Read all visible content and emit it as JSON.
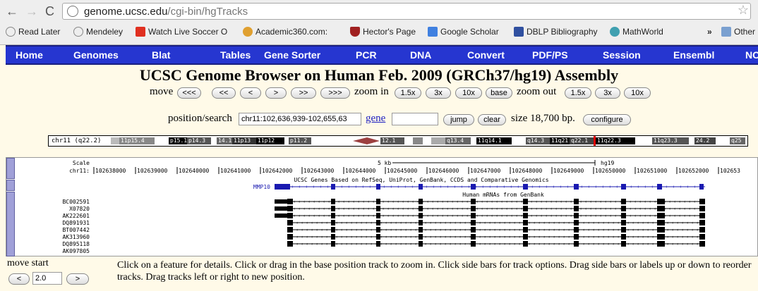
{
  "browser": {
    "url_host": "genome.ucsc.edu",
    "url_path": "/cgi-bin/hgTracks",
    "bookmarks": [
      "Read Later",
      "Mendeley",
      "Watch Live Soccer O",
      "Academic360.com:",
      "Hector's Page",
      "Google Scholar",
      "DBLP Bibliography",
      "MathWorld"
    ],
    "bookmark_more": "»",
    "other_bookmarks": "Other"
  },
  "nav": [
    "Home",
    "Genomes",
    "Blat",
    "Tables",
    "Gene Sorter",
    "PCR",
    "DNA",
    "Convert",
    "PDF/PS",
    "Session",
    "Ensembl",
    "NC"
  ],
  "page_title": "UCSC Genome Browser on Human Feb. 2009 (GRCh37/hg19) Assembly",
  "controls": {
    "move_label": "move",
    "move_buttons": [
      "<<<",
      "<<",
      "<",
      ">",
      ">>",
      ">>>"
    ],
    "zoom_in_label": "zoom in",
    "zoom_in_buttons": [
      "1.5x",
      "3x",
      "10x",
      "base"
    ],
    "zoom_out_label": "zoom out",
    "zoom_out_buttons": [
      "1.5x",
      "3x",
      "10x"
    ],
    "position_label": "position/search",
    "position_value": "chr11:102,636,939-102,655,63",
    "gene_label": "gene",
    "gene_value": "",
    "jump": "jump",
    "clear": "clear",
    "size_text": "size 18,700 bp.",
    "configure": "configure"
  },
  "ideogram": {
    "chrom": "chr11 (q22.2)",
    "bands": [
      "11p15.4",
      "p15.1",
      "p14.3",
      "14.1",
      "11p13",
      "11p12",
      "p11.2",
      "12.1",
      "q13.4",
      "11q14.1",
      "q14.3",
      "11q21",
      "q22.1",
      "11q22.3",
      "11q23.3",
      "24.2",
      "q25"
    ]
  },
  "tracks": {
    "scale_label": "Scale",
    "chr_label": "chr11:",
    "scale_bar": "5 kb",
    "assembly": "hg19",
    "positions": [
      "102638000",
      "102639000",
      "102640000",
      "102641000",
      "102642000",
      "102643000",
      "102644000",
      "102645000",
      "102646000",
      "102647000",
      "102648000",
      "102649000",
      "102650000",
      "102651000",
      "102652000",
      "102653"
    ],
    "ucsc_genes_title": "UCSC Genes Based on RefSeq, UniProt, GenBank, CCDS and Comparative Genomics",
    "gene_name": "MMP10",
    "mrna_title": "Human mRNAs from GenBank",
    "mrnas": [
      "BC002591",
      "X07820",
      "AK222601",
      "DQ891931",
      "BT007442",
      "AK313960",
      "DQ895118",
      "AK097805"
    ]
  },
  "bottom": {
    "move_start_label": "move start",
    "left_btn": "<",
    "move_value": "2.0",
    "right_btn": ">",
    "help_text": "Click on a feature for details. Click or drag in the base position track to zoom in. Click side bars for track options. Drag side bars or labels up or down to reorder tracks. Drag tracks left or right to new position."
  },
  "colors": {
    "nav_bg": "#2636d0",
    "page_bg": "#fffae8",
    "gene": "#1a1ab0",
    "mrna": "#000000",
    "centromere": "#9c4040",
    "marker": "#e00000"
  }
}
